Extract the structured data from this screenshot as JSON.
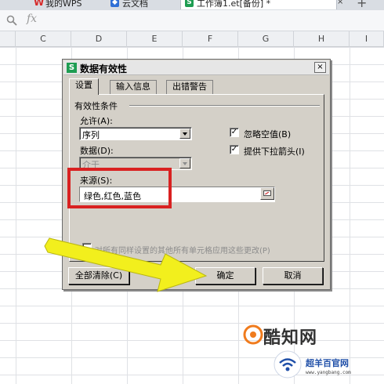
{
  "tabs": [
    {
      "label": "我的WPS",
      "icon": "wps-logo-icon"
    },
    {
      "label": "云文档",
      "icon": "cloud-doc-icon"
    },
    {
      "label": "工作簿1.et[备份] *",
      "icon": "spreadsheet-icon"
    }
  ],
  "tab_close": "×",
  "tab_add": "+",
  "formula_bar": {
    "fx": "fx"
  },
  "columns": [
    "C",
    "D",
    "E",
    "F",
    "G",
    "H",
    "I"
  ],
  "dialog": {
    "title": "数据有效性",
    "close": "×",
    "tabs": [
      "设置",
      "输入信息",
      "出错警告"
    ],
    "section_title": "有效性条件",
    "allow_label": "允许(A):",
    "allow_value": "序列",
    "data_label": "数据(D):",
    "data_value": "介于",
    "ignore_blank": {
      "label": "忽略空值(B)",
      "checked": true
    },
    "dropdown_arrow": {
      "label": "提供下拉箭头(I)",
      "checked": true
    },
    "source_label": "来源(S):",
    "source_value": "绿色,红色,蓝色",
    "apply_all_label": "对所有同样设置的其他所有单元格应用这些更改(P)",
    "buttons": {
      "clear": "全部清除(C)",
      "ok": "确定",
      "cancel": "取消"
    }
  },
  "watermark": {
    "name": "酷知网",
    "name2": "超羊百官网",
    "url": "www.yangbang.com"
  },
  "colors": {
    "highlight": "#d92121",
    "arrow": "#f2ef1d",
    "dialog_bg": "#d4d0c8"
  }
}
